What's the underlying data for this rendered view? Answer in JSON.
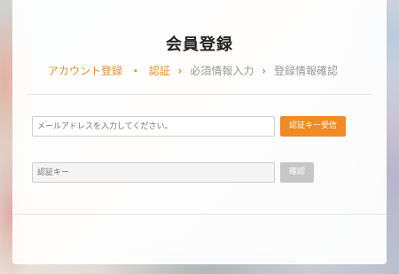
{
  "page": {
    "title": "会員登録"
  },
  "steps": [
    {
      "label": "アカウント登録",
      "state": "active"
    },
    {
      "label": "認証",
      "state": "active"
    },
    {
      "label": "必須情報入力",
      "state": "inactive"
    },
    {
      "label": "登録情報確認",
      "state": "inactive"
    }
  ],
  "separators": {
    "dot": "・",
    "chevron": "›"
  },
  "form": {
    "email_placeholder": "メールアドレスを入力してください。",
    "send_code_label": "認証キー受信",
    "code_placeholder": "認証キー",
    "confirm_label": "確認"
  },
  "colors": {
    "accent": "#f08a24",
    "step_active": "#ee8b2a",
    "step_inactive": "#999999",
    "disabled_button": "#c7c7c7"
  }
}
